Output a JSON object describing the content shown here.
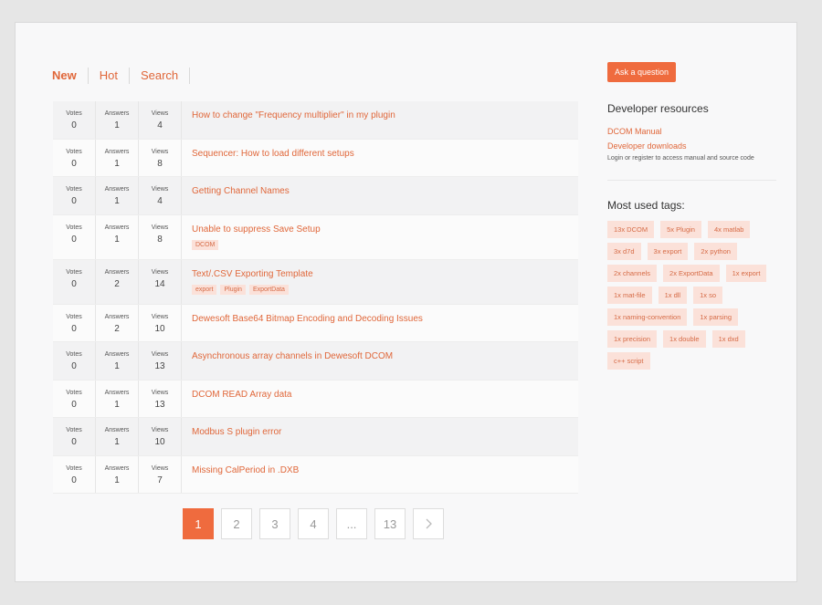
{
  "tabs": [
    "New",
    "Hot",
    "Search"
  ],
  "stat_labels": {
    "votes": "Votes",
    "answers": "Answers",
    "views": "Views"
  },
  "questions": [
    {
      "votes": "0",
      "answers": "1",
      "views": "4",
      "title": "How to change \"Frequency multiplier\" in my plugin",
      "tags": []
    },
    {
      "votes": "0",
      "answers": "1",
      "views": "8",
      "title": "Sequencer: How to load different setups",
      "tags": []
    },
    {
      "votes": "0",
      "answers": "1",
      "views": "4",
      "title": "Getting Channel Names",
      "tags": []
    },
    {
      "votes": "0",
      "answers": "1",
      "views": "8",
      "title": "Unable to suppress Save Setup",
      "tags": [
        "DCOM"
      ]
    },
    {
      "votes": "0",
      "answers": "2",
      "views": "14",
      "title": "Text/.CSV Exporting Template",
      "tags": [
        "export",
        "Plugin",
        "ExportData"
      ]
    },
    {
      "votes": "0",
      "answers": "2",
      "views": "10",
      "title": "Dewesoft Base64 Bitmap Encoding and Decoding Issues",
      "tags": []
    },
    {
      "votes": "0",
      "answers": "1",
      "views": "13",
      "title": "Asynchronous array channels in Dewesoft DCOM",
      "tags": []
    },
    {
      "votes": "0",
      "answers": "1",
      "views": "13",
      "title": "DCOM READ Array data",
      "tags": []
    },
    {
      "votes": "0",
      "answers": "1",
      "views": "10",
      "title": "Modbus S plugin error",
      "tags": []
    },
    {
      "votes": "0",
      "answers": "1",
      "views": "7",
      "title": "Missing CalPeriod in .DXB",
      "tags": []
    }
  ],
  "pagination": {
    "pages": [
      "1",
      "2",
      "3",
      "4",
      "...",
      "13"
    ],
    "current": "1",
    "next_icon": "chevron-right"
  },
  "sidebar": {
    "ask_label": "Ask a question",
    "resources_heading": "Developer resources",
    "resource_links": [
      "DCOM Manual",
      "Developer downloads"
    ],
    "login_label": "Login",
    "or_text": " or ",
    "register_label": "register",
    "access_text": " to access manual and source code",
    "tags_heading": "Most used tags:",
    "tags": [
      "13x DCOM",
      "5x Plugin",
      "4x matlab",
      "3x d7d",
      "3x export",
      "2x python",
      "2x channels",
      "2x ExportData",
      "1x export",
      "1x mat-file",
      "1x dll",
      "1x so",
      "1x naming-convention",
      "1x parsing",
      "1x precision",
      "1x double",
      "1x dxd",
      "c++ script"
    ]
  },
  "colors": {
    "accent": "#ef6b3e",
    "link": "#e0673a",
    "tag_bg": "#fbe1d9",
    "panel_bg": "#f8f8f9"
  }
}
